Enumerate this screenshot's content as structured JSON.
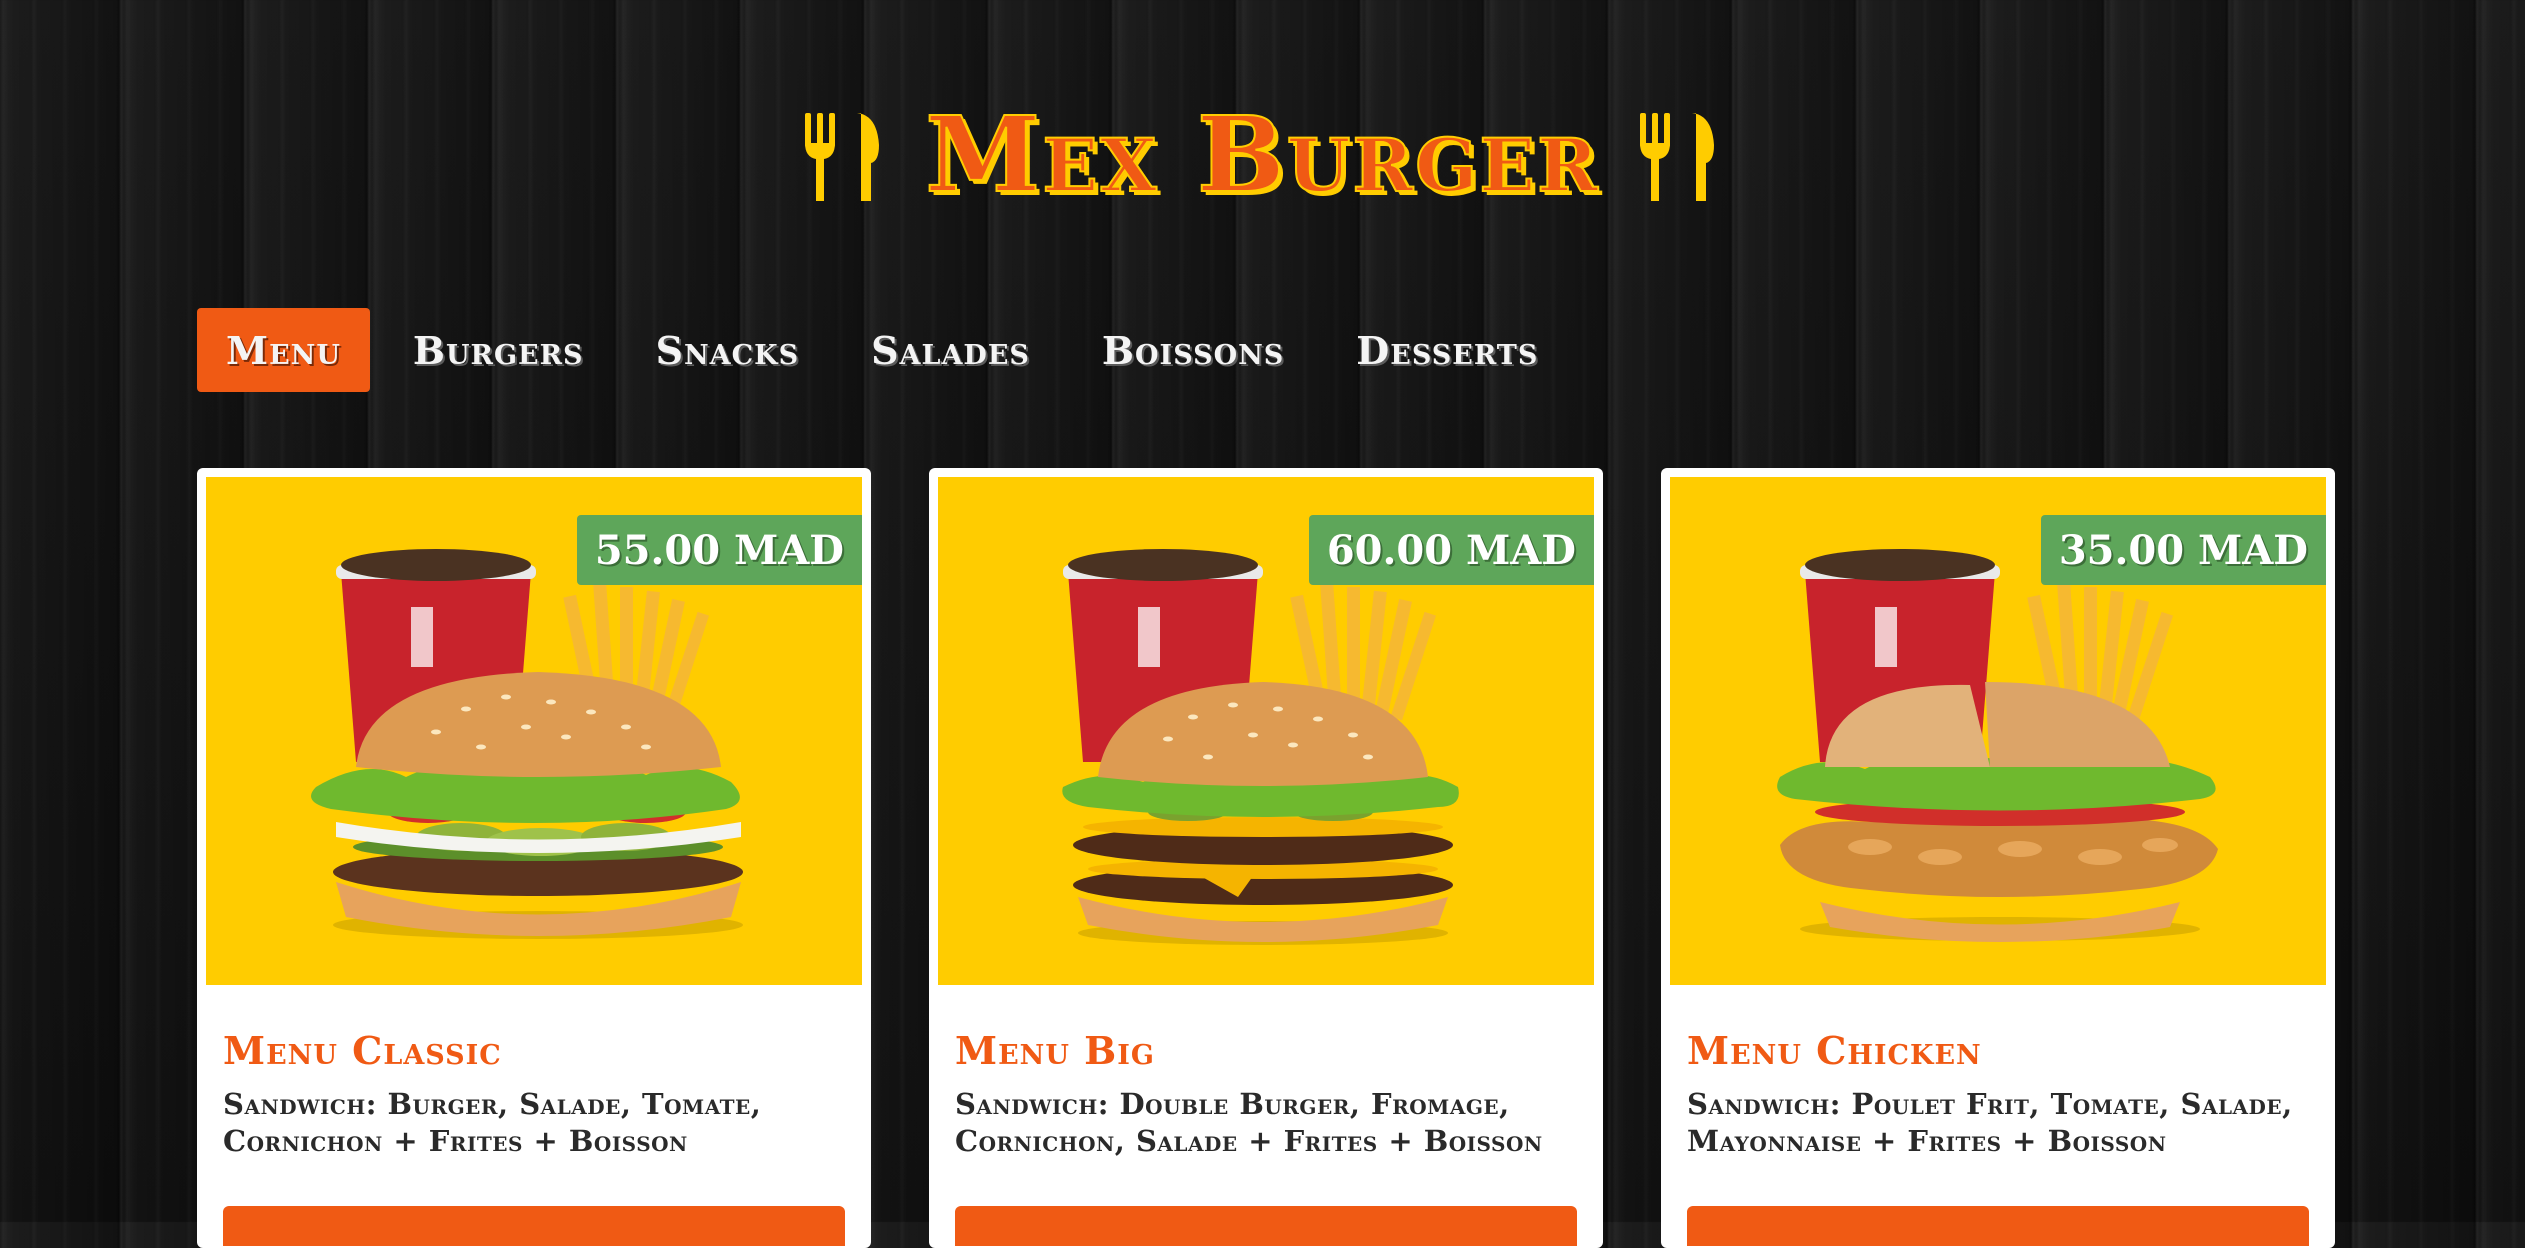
{
  "header": {
    "title": "Mex Burger",
    "left_icon": "cutlery-icon",
    "right_icon": "cutlery-icon",
    "title_color": "#f05a14",
    "accent_color": "#ffcc00"
  },
  "nav": {
    "items": [
      {
        "label": "Menu",
        "active": true
      },
      {
        "label": "Burgers",
        "active": false
      },
      {
        "label": "Snacks",
        "active": false
      },
      {
        "label": "Salades",
        "active": false
      },
      {
        "label": "Boissons",
        "active": false
      },
      {
        "label": "Desserts",
        "active": false
      }
    ],
    "active_color": "#f05a14"
  },
  "cards": [
    {
      "title": "Menu Classic",
      "price": "55.00 MAD",
      "description": "Sandwich: Burger, Salade, Tomate, Cornichon + Frites + Boisson",
      "image": "classic-burger-menu-image"
    },
    {
      "title": "Menu Big",
      "price": "60.00 MAD",
      "description": "Sandwich: Double Burger, Fromage, Cornichon, Salade + Frites + Boisson",
      "image": "big-burger-menu-image"
    },
    {
      "title": "Menu Chicken",
      "price": "35.00 MAD",
      "description": "Sandwich: Poulet Frit, Tomate, Salade, Mayonnaise + Frites + Boisson",
      "image": "chicken-burger-menu-image"
    }
  ],
  "colors": {
    "card_media_bg": "#ffcc00",
    "price_badge_bg": "#5ea65a",
    "button_bg": "#f05a14"
  }
}
